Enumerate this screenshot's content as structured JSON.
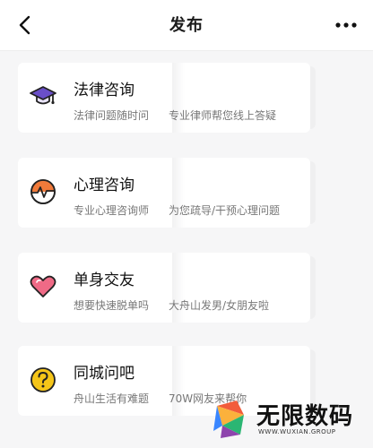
{
  "header": {
    "title": "发布",
    "back_icon": "chevron-left-icon",
    "more_icon": "more-dots-icon"
  },
  "cards": [
    {
      "title": "法律咨询",
      "subtitle_left": "法律问题随时问",
      "subtitle_right": "专业律师帮您线上答疑",
      "icon": "graduation-cap-icon",
      "accent": "#6a4fc8"
    },
    {
      "title": "心理咨询",
      "subtitle_left": "专业心理咨询师",
      "subtitle_right": "为您疏导/干预心理问题",
      "icon": "heartbeat-chart-icon",
      "accent": "#f07a3a"
    },
    {
      "title": "单身交友",
      "subtitle_left": "想要快速脱单吗",
      "subtitle_right": "大舟山发男/女朋友啦",
      "icon": "heart-icon",
      "accent": "#ef6a86"
    },
    {
      "title": "同城问吧",
      "subtitle_left": "舟山生活有难题",
      "subtitle_right": "70W网友来帮你",
      "icon": "question-circle-icon",
      "accent": "#f5c518"
    }
  ],
  "watermark": {
    "text": "无限数码",
    "url": "WWW.WUXIAN.GROUP"
  }
}
